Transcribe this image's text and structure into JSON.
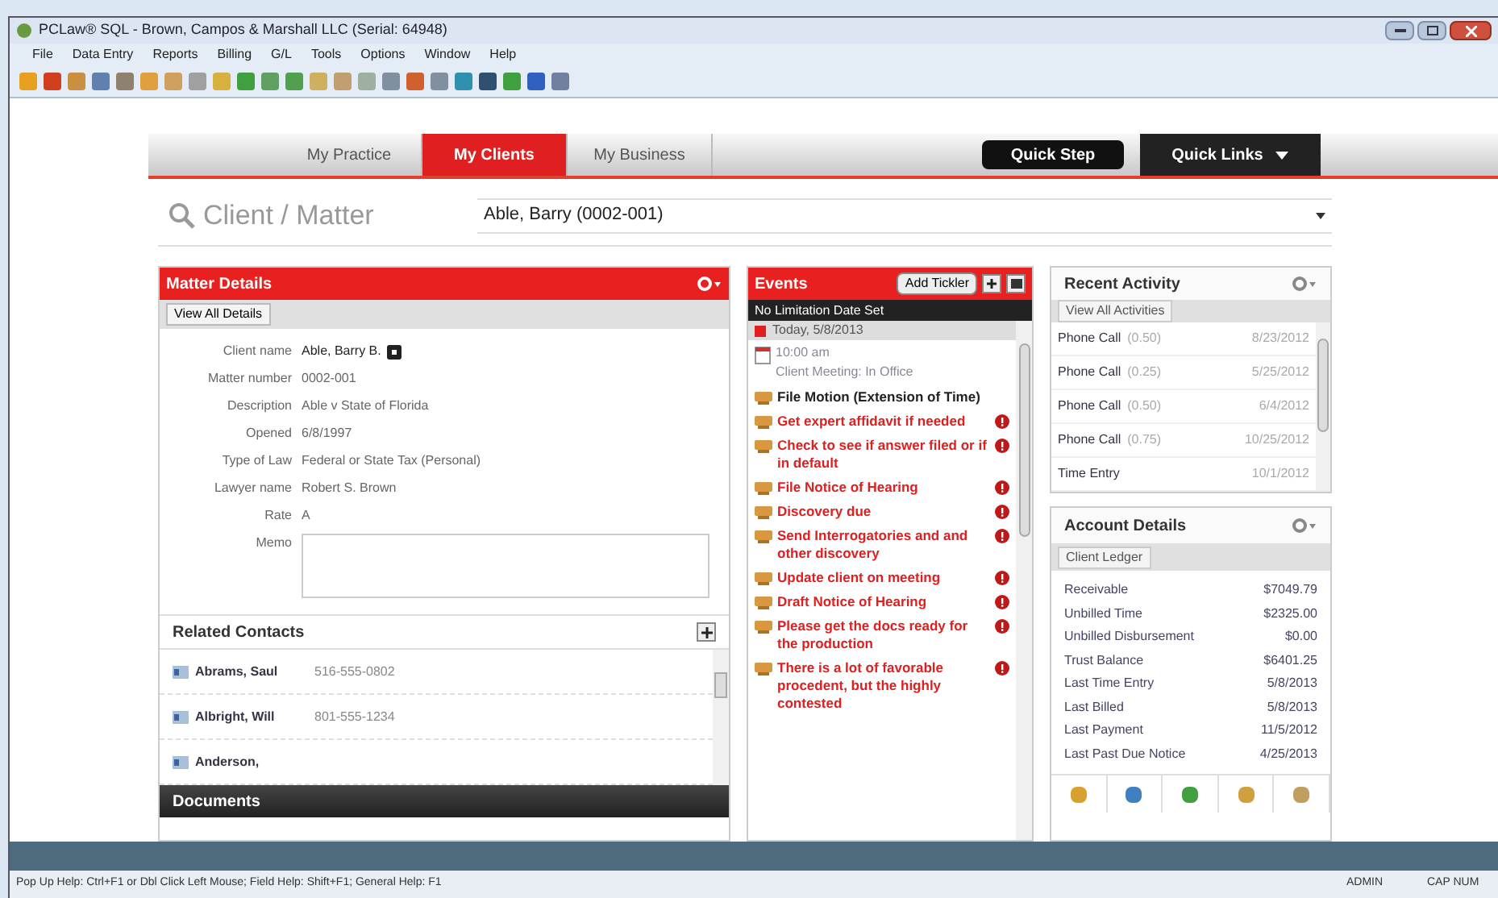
{
  "window": {
    "title": "PCLaw® SQL - Brown, Campos & Marshall LLC (Serial: 64948)"
  },
  "menu": [
    "File",
    "Data Entry",
    "Reports",
    "Billing",
    "G/L",
    "Tools",
    "Options",
    "Window",
    "Help"
  ],
  "nav": {
    "tabs": [
      {
        "label": "My Practice",
        "selected": false
      },
      {
        "label": "My Clients",
        "selected": true
      },
      {
        "label": "My Business",
        "selected": false
      }
    ],
    "buttons": [
      {
        "label": "Quick Step",
        "kind": "button"
      },
      {
        "label": "Quick Links",
        "kind": "dropdown"
      }
    ]
  },
  "client_matter": {
    "label": "Client / Matter",
    "value": "Able, Barry (0002-001)"
  },
  "matter_details": {
    "title": "Matter Details",
    "view_all": "View All Details",
    "fields": [
      {
        "label": "Client name",
        "value": "Able, Barry B.",
        "kind": "link"
      },
      {
        "label": "Matter number",
        "value": "0002-001",
        "kind": "text"
      },
      {
        "label": "Description",
        "value": "Able v State of Florida",
        "kind": "text"
      },
      {
        "label": "Opened",
        "value": "6/8/1997",
        "kind": "text"
      },
      {
        "label": "Type of Law",
        "value": "Federal or State Tax (Personal)",
        "kind": "text"
      },
      {
        "label": "Lawyer name",
        "value": "Robert S. Brown",
        "kind": "text"
      },
      {
        "label": "Rate",
        "value": "A",
        "kind": "text"
      },
      {
        "label": "Memo",
        "kind": "memo"
      }
    ]
  },
  "related_contacts": {
    "title": "Related Contacts",
    "rows": [
      {
        "name": "Abrams, Saul",
        "phone": "516-555-0802"
      },
      {
        "name": "Albright, Will",
        "phone": "801-555-1234"
      },
      {
        "name": "Anderson,"
      }
    ]
  },
  "documents": {
    "title": "Documents"
  },
  "events": {
    "title": "Events",
    "add_button": "Add Tickler",
    "filter": "No Limitation Date Set",
    "date": "Today, 5/8/2013",
    "items": [
      {
        "kind": "appointment",
        "time": "10:00 am",
        "text": "Client Meeting: In Office"
      },
      {
        "kind": "tickler",
        "text": "File Motion (Extension of Time)",
        "overdue": false
      },
      {
        "kind": "tickler",
        "text": "Get expert affidavit if needed",
        "overdue": true
      },
      {
        "kind": "tickler",
        "text": "Check to see if answer filed or if in default",
        "overdue": true
      },
      {
        "kind": "tickler",
        "text": "File Notice of Hearing",
        "overdue": true
      },
      {
        "kind": "tickler",
        "text": "Discovery due",
        "overdue": true
      },
      {
        "kind": "tickler",
        "text": "Send Interrogatories and and other discovery",
        "overdue": true
      },
      {
        "kind": "tickler",
        "text": "Update client on meeting",
        "overdue": true
      },
      {
        "kind": "tickler",
        "text": "Draft Notice of Hearing",
        "overdue": true
      },
      {
        "kind": "tickler",
        "text": "Please get the docs ready for the production",
        "overdue": true
      },
      {
        "kind": "tickler",
        "text": "There is a lot of favorable procedent, but the highly contested",
        "overdue": true
      }
    ]
  },
  "recent_activity": {
    "title": "Recent Activity",
    "view_all": "View All Activities",
    "rows": [
      {
        "activity": "Phone Call",
        "hours": "(0.50)",
        "date": "8/23/2012"
      },
      {
        "activity": "Phone Call",
        "hours": "(0.25)",
        "date": "5/25/2012"
      },
      {
        "activity": "Phone Call",
        "hours": "(0.50)",
        "date": "6/4/2012"
      },
      {
        "activity": "Phone Call",
        "hours": "(0.75)",
        "date": "10/25/2012"
      },
      {
        "activity": "Time Entry",
        "date": "10/1/2012"
      }
    ]
  },
  "account_details": {
    "title": "Account Details",
    "ledger_button": "Client Ledger",
    "rows": [
      {
        "label": "Receivable",
        "value": "$7049.79"
      },
      {
        "label": "Unbilled Time",
        "value": "$2325.00"
      },
      {
        "label": "Unbilled Disbursement",
        "value": "$0.00"
      },
      {
        "label": "Trust Balance",
        "value": "$6401.25"
      },
      {
        "label": "Last Time Entry",
        "value": "5/8/2013"
      },
      {
        "label": "Last Billed",
        "value": "5/8/2013"
      },
      {
        "label": "Last Payment",
        "value": "11/5/2012"
      },
      {
        "label": "Last Past Due Notice",
        "value": "4/25/2013"
      }
    ]
  },
  "status_bar": {
    "help": "Pop Up Help: Ctrl+F1 or Dbl Click Left Mouse; Field Help: Shift+F1; General Help: F1",
    "user": "ADMIN",
    "keys": "CAP NUM"
  }
}
